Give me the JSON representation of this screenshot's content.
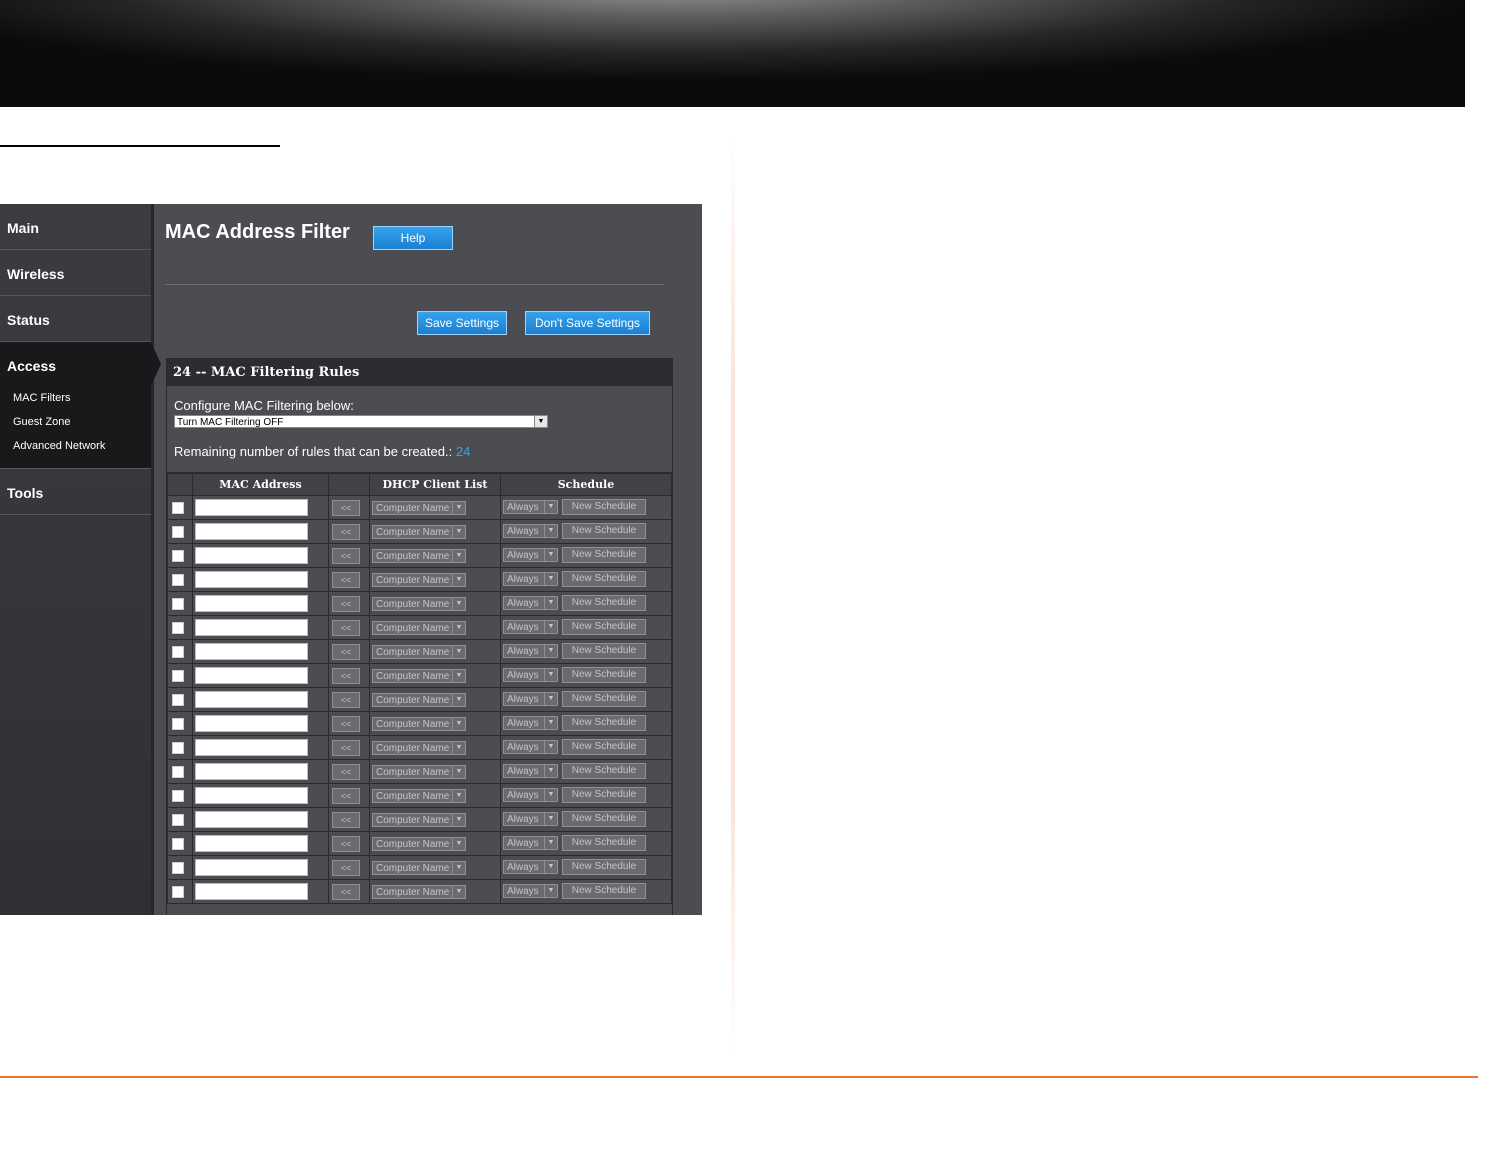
{
  "nav": {
    "main": "Main",
    "wireless": "Wireless",
    "status": "Status",
    "access": "Access",
    "access_sub": [
      "MAC Filters",
      "Guest Zone",
      "Advanced Network"
    ],
    "tools": "Tools"
  },
  "page": {
    "title": "MAC Address Filter",
    "help": "Help",
    "save": "Save Settings",
    "dont_save": "Don't Save Settings"
  },
  "panel": {
    "header": "24 -- MAC Filtering Rules",
    "configure_label": "Configure MAC Filtering below:",
    "filter_mode": "Turn MAC Filtering OFF",
    "remaining_label": "Remaining number of rules that can be created.:",
    "remaining_count": "24"
  },
  "table": {
    "headers": [
      "MAC Address",
      "DHCP Client List",
      "Schedule"
    ],
    "arrow_label": "<<",
    "computer_name_placeholder": "Computer Name",
    "schedule_value": "Always",
    "new_schedule_label": "New Schedule",
    "visible_rows": 17
  },
  "colors": {
    "accent_blue": "#1b8fe0",
    "footer_rule": "#e8762d"
  }
}
